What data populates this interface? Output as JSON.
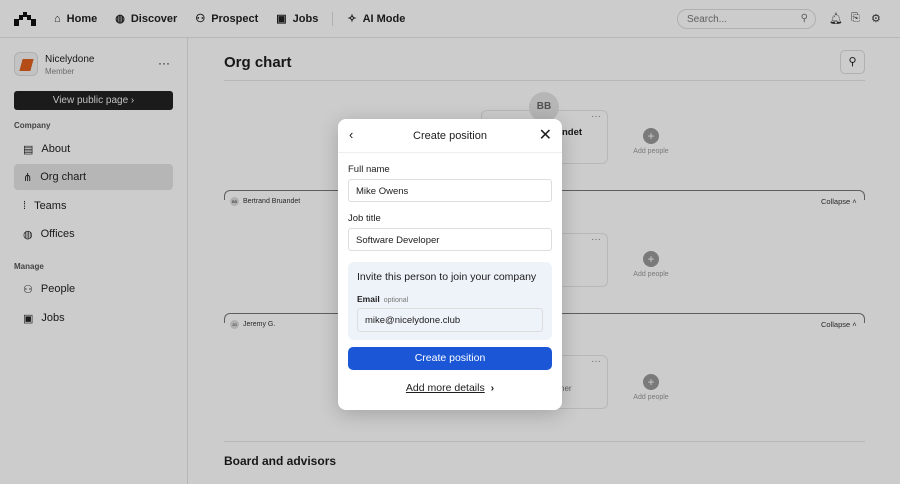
{
  "nav": {
    "home": "Home",
    "discover": "Discover",
    "prospect": "Prospect",
    "jobs": "Jobs",
    "ai_mode": "AI Mode",
    "search_placeholder": "Search..."
  },
  "sidebar": {
    "org_name": "Nicelydone",
    "role": "Member",
    "view_public": "View public page",
    "company_heading": "Company",
    "company_items": [
      "About",
      "Org chart",
      "Teams",
      "Offices"
    ],
    "manage_heading": "Manage",
    "manage_items": [
      "People",
      "Jobs"
    ]
  },
  "main": {
    "title": "Org chart",
    "top_initials": "BB",
    "top_name_fragment": "ndet",
    "add_people": "Add people",
    "groups": [
      {
        "initials": "BB",
        "name": "Bertrand Bruandet",
        "collapse": "Collapse"
      },
      {
        "initials": "JG",
        "name": "Jeremy G.",
        "collapse": "Collapse"
      }
    ],
    "card3_fragment": "ner",
    "board_title": "Board and advisors"
  },
  "modal": {
    "title": "Create position",
    "full_name_label": "Full name",
    "full_name_value": "Mike Owens",
    "job_title_label": "Job title",
    "job_title_value": "Software Developer",
    "invite_title": "Invite this person to join your company",
    "email_label": "Email",
    "email_optional": "optional",
    "email_value": "mike@nicelydone.club",
    "create_button": "Create position",
    "more_details": "Add more details"
  }
}
